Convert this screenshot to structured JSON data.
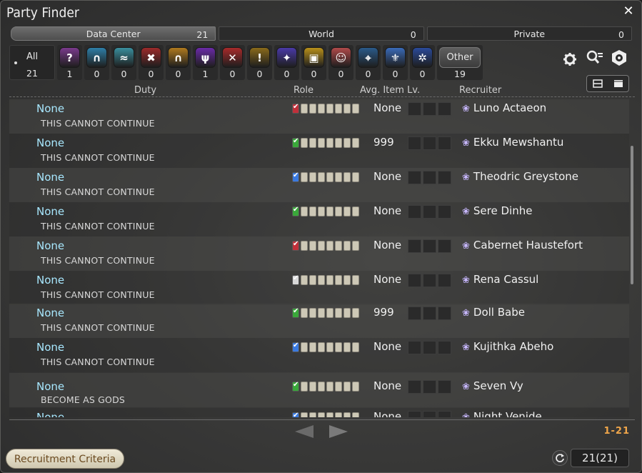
{
  "window": {
    "title": "Party Finder"
  },
  "tabs": [
    {
      "label": "Data Center",
      "count": "21"
    },
    {
      "label": "World",
      "count": "0"
    },
    {
      "label": "Private",
      "count": "0"
    }
  ],
  "jobs": {
    "all_label": "All",
    "all_count": "21",
    "items": [
      {
        "icon": "question-icon",
        "count": "1",
        "color": "#7a3a8c"
      },
      {
        "icon": "arch-icon",
        "count": "0",
        "color": "#2e7fa8"
      },
      {
        "icon": "scroll-icon",
        "count": "0",
        "color": "#3a8f9e"
      },
      {
        "icon": "mask-icon",
        "count": "0",
        "color": "#9c2a2a"
      },
      {
        "icon": "gate-icon",
        "count": "0",
        "color": "#b07a1e"
      },
      {
        "icon": "demon-icon",
        "count": "1",
        "color": "#6a2aa8"
      },
      {
        "icon": "crossed-swords-icon",
        "count": "0",
        "color": "#a82a2a"
      },
      {
        "icon": "exclaim-icon",
        "count": "0",
        "color": "#8a6a1a"
      },
      {
        "icon": "star-icon",
        "count": "0",
        "color": "#4a3aa8"
      },
      {
        "icon": "chest-icon",
        "count": "0",
        "color": "#b8901a"
      },
      {
        "icon": "face-icon",
        "count": "0",
        "color": "#b04a4a"
      },
      {
        "icon": "map-icon",
        "count": "0",
        "color": "#2a5a8a"
      },
      {
        "icon": "fleur-icon",
        "count": "0",
        "color": "#3a6ab8"
      },
      {
        "icon": "gear-icon",
        "count": "0",
        "color": "#2a4a9a"
      }
    ],
    "other_label": "Other",
    "other_count": "19"
  },
  "headers": {
    "duty": "Duty",
    "role": "Role",
    "ilvl": "Avg. Item Lv.",
    "recruiter": "Recruiter"
  },
  "rows": [
    {
      "duty": "None",
      "desc": "THIS CANNOT CONTINUE",
      "ilvl": "None",
      "recruiter": "Luno Actaeon",
      "lead_color": "#c0303a"
    },
    {
      "duty": "None",
      "desc": "THIS CANNOT CONTINUE",
      "ilvl": "999",
      "recruiter": "Ekku Mewshantu",
      "lead_color": "#3aa83a"
    },
    {
      "duty": "None",
      "desc": "THIS CANNOT CONTINUE",
      "ilvl": "None",
      "recruiter": "Theodric Greystone",
      "lead_color": "#3a7ae0"
    },
    {
      "duty": "None",
      "desc": "THIS CANNOT CONTINUE",
      "ilvl": "None",
      "recruiter": "Sere Dinhe",
      "lead_color": "#3aa83a"
    },
    {
      "duty": "None",
      "desc": "THIS CANNOT CONTINUE",
      "ilvl": "None",
      "recruiter": "Cabernet Haustefort",
      "lead_color": "#c0303a"
    },
    {
      "duty": "None",
      "desc": "THIS CANNOT CONTINUE",
      "ilvl": "None",
      "recruiter": "Rena Cassul",
      "lead_color": "#d8d8d8"
    },
    {
      "duty": "None",
      "desc": "THIS CANNOT CONTINUE",
      "ilvl": "999",
      "recruiter": "Doll Babe",
      "lead_color": "#3aa83a"
    },
    {
      "duty": "None",
      "desc": "THIS CANNOT CONTINUE",
      "ilvl": "None",
      "recruiter": "Kujithka Abeho",
      "lead_color": "#3a7ae0"
    },
    {
      "duty": "None",
      "desc": "BECOME AS GODS",
      "ilvl": "None",
      "recruiter": "Seven Vy",
      "lead_color": "#3aa83a"
    },
    {
      "duty": "None",
      "desc": "",
      "ilvl": "None",
      "recruiter": "Night Venide",
      "lead_color": "#3a7ae0"
    }
  ],
  "pagination": {
    "label": "1-21"
  },
  "footer": {
    "criteria_label": "Recruitment Criteria",
    "total": "21(21)"
  },
  "world_icon": "❀"
}
